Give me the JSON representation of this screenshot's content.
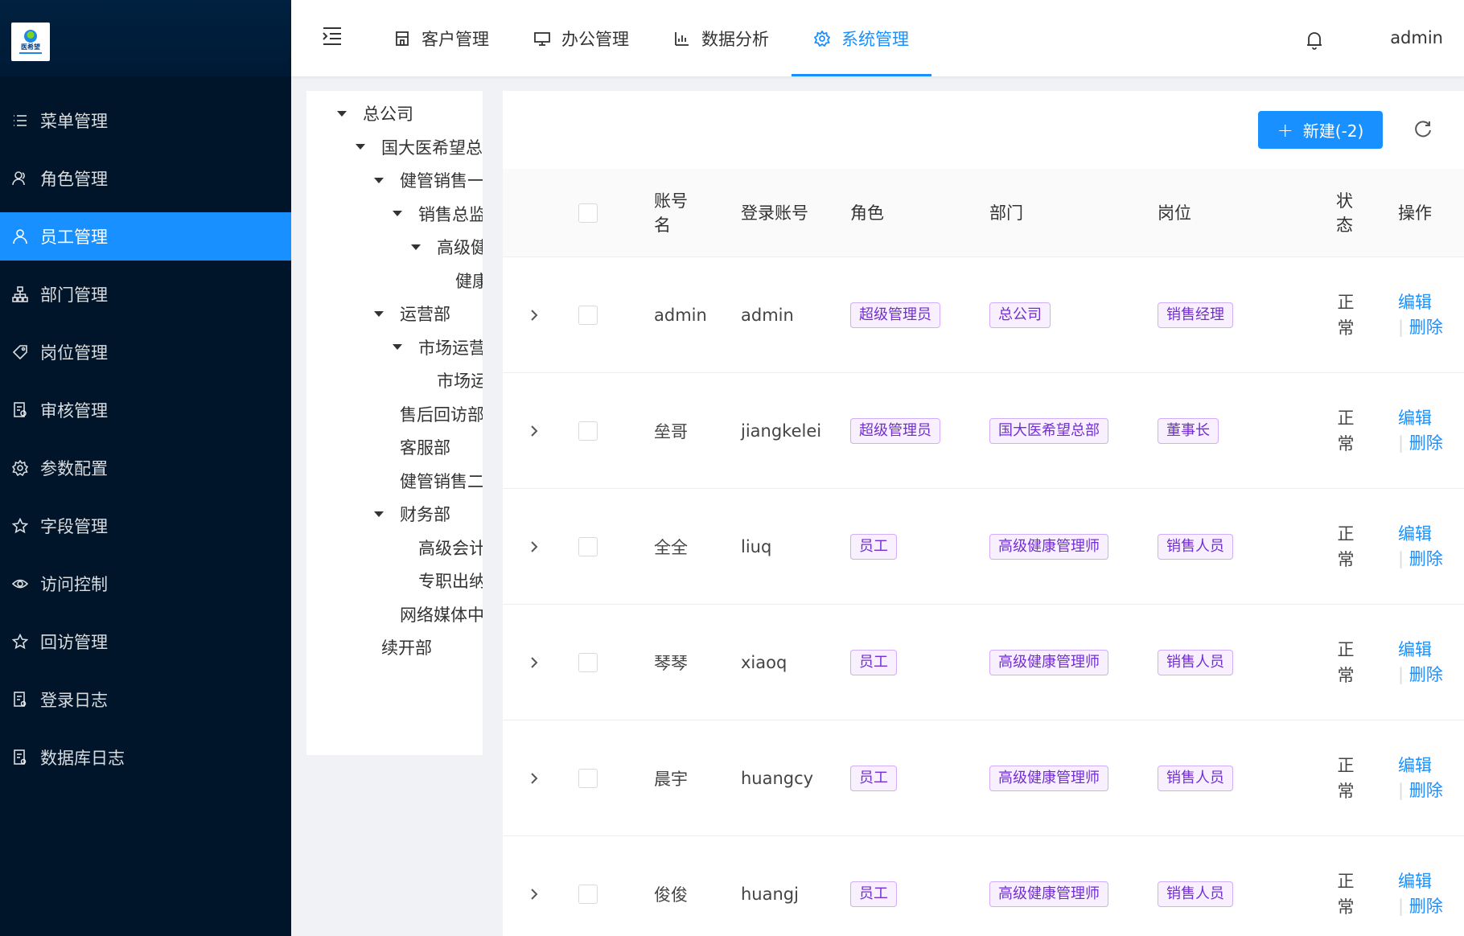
{
  "app": {
    "user": "admin",
    "logo_text": "医希望"
  },
  "sidebar": {
    "items": [
      {
        "label": "菜单管理",
        "icon": "list-icon",
        "active": false
      },
      {
        "label": "角色管理",
        "icon": "users-icon",
        "active": false
      },
      {
        "label": "员工管理",
        "icon": "user-icon",
        "active": true
      },
      {
        "label": "部门管理",
        "icon": "org-chart-icon",
        "active": false
      },
      {
        "label": "岗位管理",
        "icon": "tag-icon",
        "active": false
      },
      {
        "label": "审核管理",
        "icon": "audit-icon",
        "active": false
      },
      {
        "label": "参数配置",
        "icon": "gear-icon",
        "active": false
      },
      {
        "label": "字段管理",
        "icon": "star-icon",
        "active": false
      },
      {
        "label": "访问控制",
        "icon": "eye-icon",
        "active": false
      },
      {
        "label": "回访管理",
        "icon": "star-icon",
        "active": false
      },
      {
        "label": "登录日志",
        "icon": "log-icon",
        "active": false
      },
      {
        "label": "数据库日志",
        "icon": "log-icon",
        "active": false
      }
    ]
  },
  "header": {
    "tabs": [
      {
        "label": "客户管理",
        "icon": "building-icon",
        "active": false
      },
      {
        "label": "办公管理",
        "icon": "monitor-icon",
        "active": false
      },
      {
        "label": "数据分析",
        "icon": "bar-chart-icon",
        "active": false
      },
      {
        "label": "系统管理",
        "icon": "gear-icon",
        "active": true
      }
    ]
  },
  "tree": {
    "nodes": [
      {
        "label": "总公司",
        "level": 0,
        "expanded": true
      },
      {
        "label": "国大医希望总部",
        "level": 1,
        "expanded": true
      },
      {
        "label": "健管销售一中心",
        "level": 2,
        "expanded": true
      },
      {
        "label": "销售总监",
        "level": 3,
        "expanded": true
      },
      {
        "label": "高级健康管理师",
        "level": 4,
        "expanded": true
      },
      {
        "label": "健康管理师",
        "level": 5,
        "expanded": false,
        "leaf": true
      },
      {
        "label": "运营部",
        "level": 2,
        "expanded": true
      },
      {
        "label": "市场运营",
        "level": 3,
        "expanded": true
      },
      {
        "label": "市场运营专员",
        "level": 4,
        "leaf": true
      },
      {
        "label": "售后回访部",
        "level": 2,
        "leaf": true
      },
      {
        "label": "客服部",
        "level": 2,
        "leaf": true
      },
      {
        "label": "健管销售二中心",
        "level": 2,
        "leaf": true
      },
      {
        "label": "财务部",
        "level": 2,
        "expanded": true
      },
      {
        "label": "高级会计",
        "level": 3,
        "leaf": true
      },
      {
        "label": "专职出纳",
        "level": 3,
        "leaf": true
      },
      {
        "label": "网络媒体中心",
        "level": 2,
        "leaf": true
      },
      {
        "label": "续开部",
        "level": 1,
        "leaf": true
      }
    ]
  },
  "toolbar": {
    "new_label": "新建(-2)",
    "plus": "+"
  },
  "table": {
    "headers": {
      "account_name": "账号名",
      "login": "登录账号",
      "role": "角色",
      "dept": "部门",
      "post": "岗位",
      "status": "状态",
      "ops": "操作"
    },
    "rows": [
      {
        "name": "admin",
        "login": "admin",
        "role": "超级管理员",
        "dept": "总公司",
        "post": "销售经理",
        "status": "正常"
      },
      {
        "name": "垒哥",
        "login": "jiangkelei",
        "role": "超级管理员",
        "dept": "国大医希望总部",
        "post": "董事长",
        "status": "正常"
      },
      {
        "name": "全全",
        "login": "liuq",
        "role": "员工",
        "dept": "高级健康管理师",
        "post": "销售人员",
        "status": "正常"
      },
      {
        "name": "琴琴",
        "login": "xiaoq",
        "role": "员工",
        "dept": "高级健康管理师",
        "post": "销售人员",
        "status": "正常"
      },
      {
        "name": "晨宇",
        "login": "huangcy",
        "role": "员工",
        "dept": "高级健康管理师",
        "post": "销售人员",
        "status": "正常"
      },
      {
        "name": "俊俊",
        "login": "huangj",
        "role": "员工",
        "dept": "高级健康管理师",
        "post": "销售人员",
        "status": "正常"
      }
    ],
    "ops": {
      "edit": "编辑",
      "delete": "删除"
    }
  },
  "colors": {
    "primary": "#1890ff",
    "sidebar_bg": "#001529",
    "tag_purple": "#722ed1"
  }
}
